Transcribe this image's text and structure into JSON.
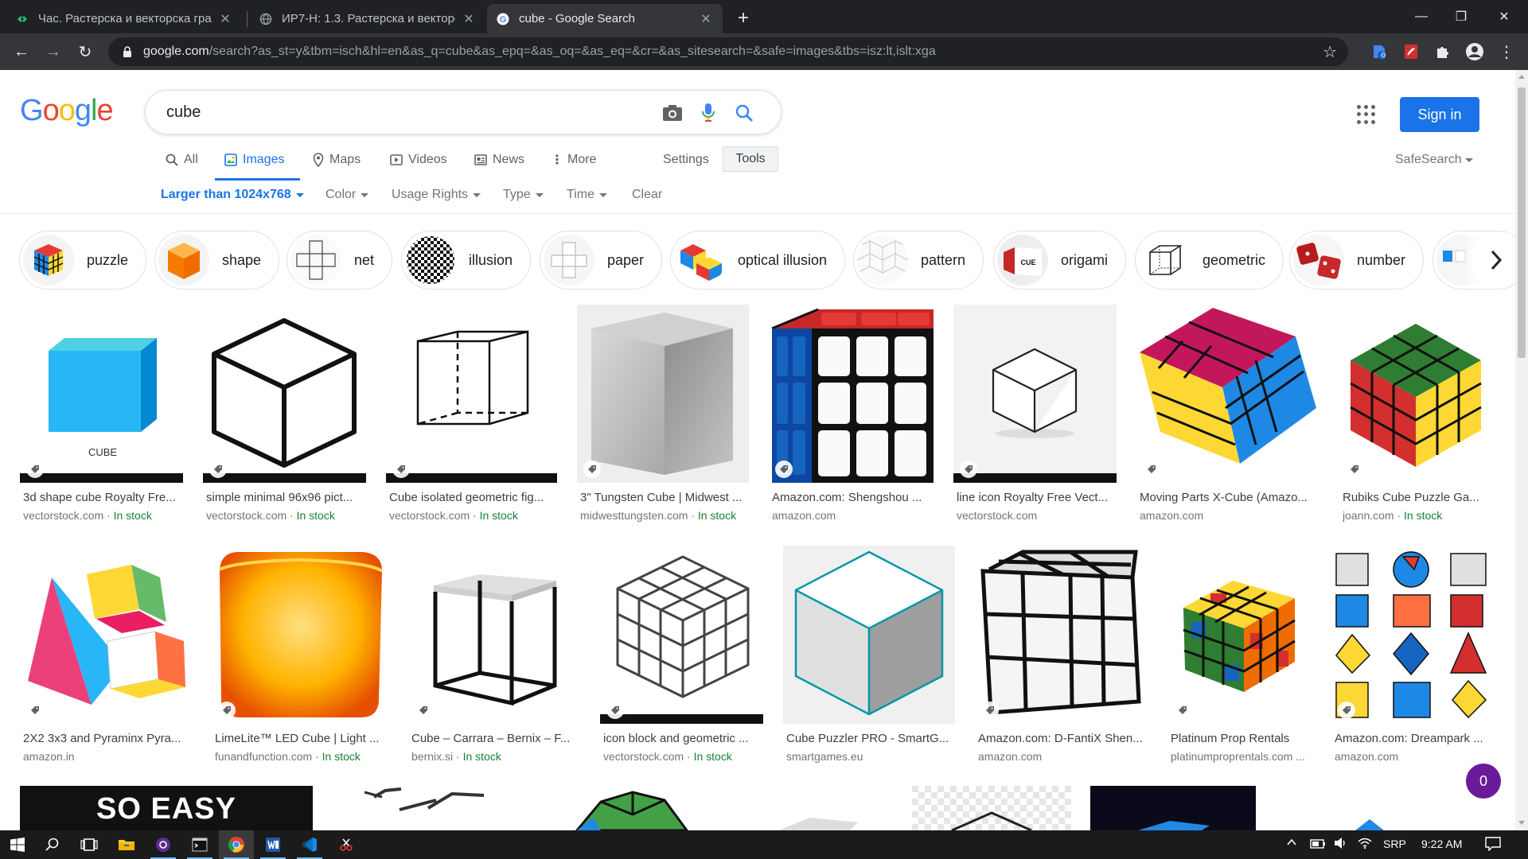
{
  "browser": {
    "tabs": [
      {
        "title": "Час. Растерска и векторска граф",
        "favicon": "eclass-icon"
      },
      {
        "title": "ИР7-Н: 1.3. Растерска и векторс",
        "favicon": "globe-icon"
      },
      {
        "title": "cube - Google Search",
        "favicon": "google-icon"
      }
    ],
    "url_host": "google.com",
    "url_rest": "/search?as_st=y&tbm=isch&hl=en&as_q=cube&as_epq=&as_oq=&as_eq=&cr=&as_sitesearch=&safe=images&tbs=isz:lt,islt:xga",
    "extension_badge": "0"
  },
  "google": {
    "logo": [
      "G",
      "o",
      "o",
      "g",
      "l",
      "e"
    ],
    "logo_colors": [
      "#4285f4",
      "#ea4335",
      "#fbbc05",
      "#4285f4",
      "#34a853",
      "#ea4335"
    ],
    "query": "cube",
    "nav": {
      "all": "All",
      "images": "Images",
      "maps": "Maps",
      "videos": "Videos",
      "news": "News",
      "more": "More",
      "settings": "Settings",
      "tools": "Tools"
    },
    "filters": {
      "size": "Larger than 1024x768",
      "color": "Color",
      "usage": "Usage Rights",
      "type": "Type",
      "time": "Time",
      "clear": "Clear"
    },
    "sign_in": "Sign in",
    "safesearch": "SafeSearch",
    "chips": [
      "puzzle",
      "shape",
      "net",
      "illusion",
      "paper",
      "optical illusion",
      "pattern",
      "origami",
      "geometric",
      "number"
    ],
    "in_stock": "In stock",
    "row1": [
      {
        "title": "3d shape cube Royalty Fre...",
        "source": "vectorstock.com · ",
        "stock": true
      },
      {
        "title": "simple minimal 96x96 pict...",
        "source": "vectorstock.com · ",
        "stock": true
      },
      {
        "title": "Cube isolated geometric fig...",
        "source": "vectorstock.com · ",
        "stock": true
      },
      {
        "title": "3\" Tungsten Cube | Midwest ...",
        "source": "midwesttungsten.com · ",
        "stock": true
      },
      {
        "title": "Amazon.com: Shengshou ...",
        "source": "amazon.com",
        "stock": false
      },
      {
        "title": "line icon Royalty Free Vect...",
        "source": "vectorstock.com",
        "stock": false
      },
      {
        "title": "Moving Parts X-Cube (Amazo...",
        "source": "amazon.com",
        "stock": false
      },
      {
        "title": "Rubiks Cube Puzzle Ga...",
        "source": "joann.com · ",
        "stock": true
      }
    ],
    "row2": [
      {
        "title": "2X2 3x3 and Pyraminx Pyra...",
        "source": "amazon.in",
        "stock": false
      },
      {
        "title": "LimeLite™ LED Cube | Light ...",
        "source": "funandfunction.com · ",
        "stock": true
      },
      {
        "title": "Cube – Carrara – Bernix – F...",
        "source": "bernix.si · ",
        "stock": true
      },
      {
        "title": "icon block and geometric ...",
        "source": "vectorstock.com · ",
        "stock": true
      },
      {
        "title": "Cube Puzzler PRO - SmartG...",
        "source": "smartgames.eu",
        "stock": false
      },
      {
        "title": "Amazon.com: D-FantiX Shen...",
        "source": "amazon.com",
        "stock": false
      },
      {
        "title": "Platinum Prop Rentals",
        "source": "platinumproprentals.com ...",
        "stock": false
      },
      {
        "title": "Amazon.com: Dreampark ...",
        "source": "amazon.com",
        "stock": false
      }
    ],
    "cube_label": "CUBE",
    "origami_label": "CUE",
    "banner_text": "SO EASY",
    "fab_label": "0"
  },
  "taskbar": {
    "lang": "SRP",
    "time": "9:22 AM"
  },
  "colors": {
    "accent": "#1a73e8",
    "stock_green": "#188038"
  }
}
